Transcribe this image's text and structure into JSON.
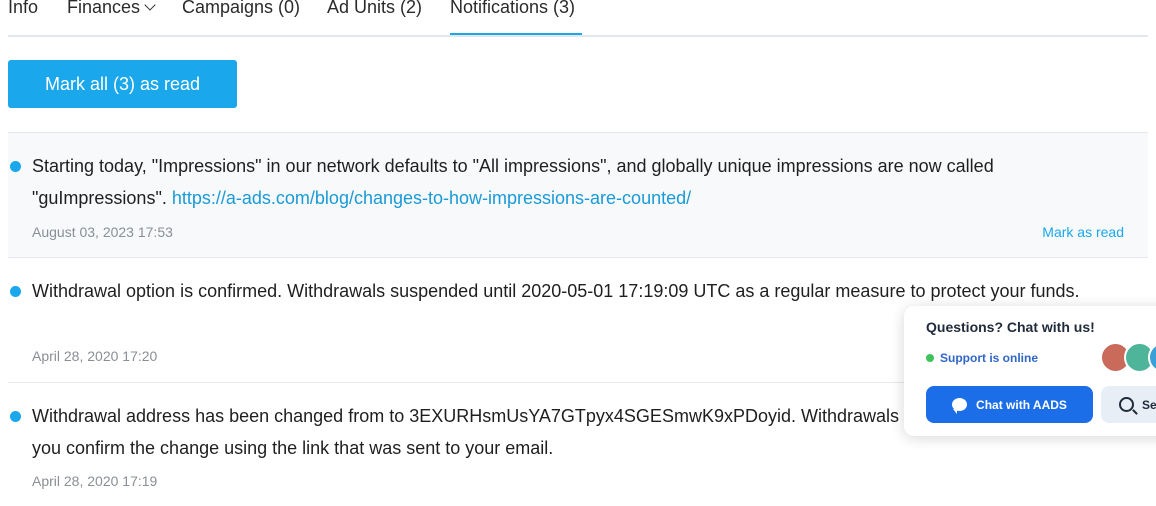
{
  "tabs": [
    {
      "label": "Info"
    },
    {
      "label": "Finances"
    },
    {
      "label": "Campaigns (0)"
    },
    {
      "label": "Ad Units (2)"
    },
    {
      "label": "Notifications (3)"
    }
  ],
  "active_tab": "Notifications (3)",
  "mark_all_label": "Mark all (3) as read",
  "notifications": [
    {
      "text": "Starting today, \"Impressions\" in our network defaults to \"All impressions\", and globally unique impressions are now called \"guImpressions\".",
      "link": "https://a-ads.com/blog/changes-to-how-impressions-are-counted/",
      "date": "August 03, 2023 17:53",
      "mark_read_label": "Mark as read",
      "unread": true
    },
    {
      "text": "Withdrawal option is confirmed. Withdrawals suspended until 2020-05-01 17:19:09 UTC as a regular measure to protect your funds.",
      "date": "April 28, 2020 17:20",
      "unread": true
    },
    {
      "text": "Withdrawal address has been changed from to 3EXURHsmUsYA7GTpyx4SGESmwK9xPDoyid. Withdrawals are suspended until you confirm the change using the link that was sent to your email.",
      "date": "April 28, 2020 17:19",
      "unread": true
    }
  ],
  "chat_widget": {
    "title": "Questions? Chat with us!",
    "status": "Support is online",
    "chat_button": "Chat with AADS",
    "search_button": "Search",
    "colors": {
      "primary": "#1c6ee8",
      "online": "#3cc45a"
    }
  },
  "colors": {
    "accent": "#1aa7ec",
    "link": "#1a9ad6",
    "muted": "#8a8f95"
  }
}
